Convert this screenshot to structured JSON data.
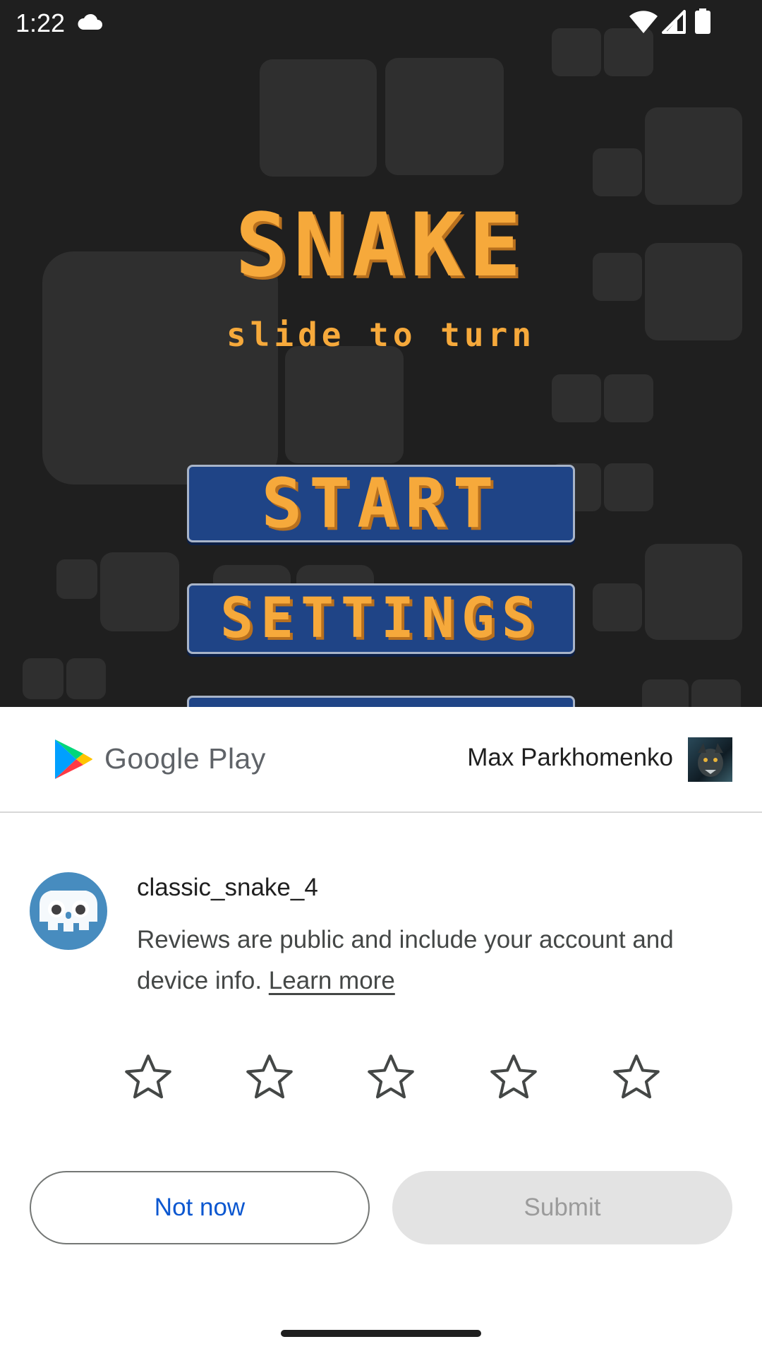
{
  "status_bar": {
    "time": "1:22"
  },
  "game": {
    "title": "SNAKE",
    "subtitle": "slide to turn",
    "buttons": [
      "START",
      "SETTINGS"
    ]
  },
  "review_sheet": {
    "store_name": "Google Play",
    "account_name": "Max Parkhomenko",
    "app_name": "classic_snake_4",
    "disclaimer": "Reviews are public and include your account and device info.",
    "learn_more": "Learn more",
    "rating": 0,
    "max_rating": 5,
    "not_now_label": "Not now",
    "submit_label": "Submit",
    "colors": {
      "accent": "#0b57d0",
      "disabled_bg": "#e3e3e3"
    }
  }
}
